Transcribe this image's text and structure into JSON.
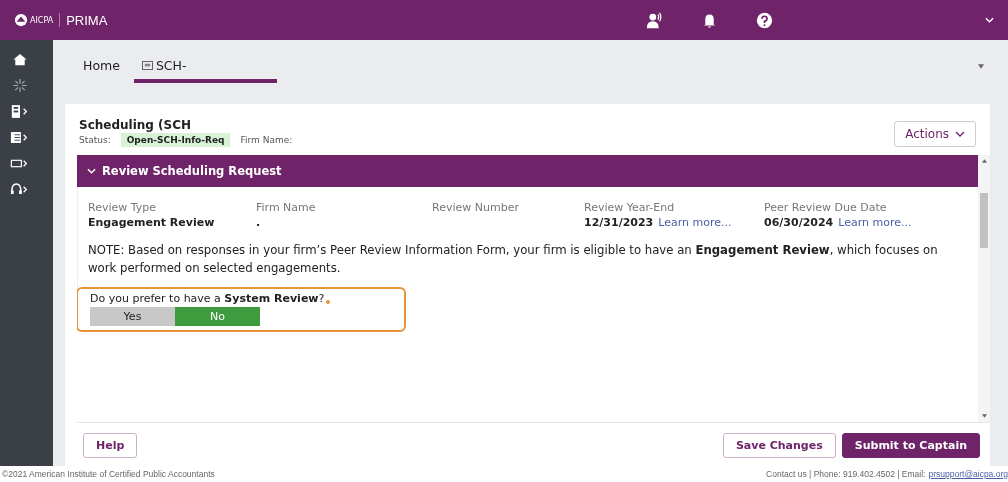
{
  "app": {
    "brand": "AICPA",
    "product": "PRIMA"
  },
  "tabs": [
    {
      "label": "Home",
      "selected": false
    },
    {
      "label": "SCH-",
      "selected": true
    }
  ],
  "record": {
    "title": "Scheduling (SCH",
    "status_label": "Status:",
    "status": "Open-SCH-Info-Req",
    "firm_label": "Firm Name:",
    "actions": "Actions"
  },
  "section": {
    "title": "Review Scheduling Request",
    "expanded": true,
    "fields": [
      {
        "label": "Review Type",
        "value": "Engagement Review"
      },
      {
        "label": "Firm Name",
        "value": "."
      },
      {
        "label": "Review Number"
      },
      {
        "label": "Review Year-End",
        "value": "12/31/2023",
        "link": "Learn more..."
      },
      {
        "label": "Peer Review Due Date",
        "value": "06/30/2024",
        "link": "Learn more..."
      }
    ],
    "note": "NOTE: Based on responses in your firm’s Peer Review Information Form, your firm is eligible to have an **Engagement Review**, which focuses on work performed on selected engagements.",
    "question": {
      "text": "Do you prefer to have a **System Review**?",
      "required": true,
      "options": [
        {
          "label": "Yes",
          "selected": false
        },
        {
          "label": "No",
          "selected": true
        }
      ]
    }
  },
  "buttons": {
    "help": "Help",
    "save": "Save Changes",
    "submit": "Submit to Captain"
  },
  "footer": {
    "copyright": "©2021 American Institute of Certified Public Accountants",
    "contact": "Contact us | Phone: 919.402.4502 | Email:",
    "email": "prsupport@aicpa.org"
  }
}
